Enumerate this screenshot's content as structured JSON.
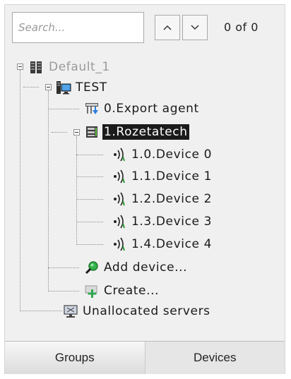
{
  "search": {
    "placeholder": "Search...",
    "value": ""
  },
  "counter": {
    "text": "0 of 0"
  },
  "tree": {
    "root": {
      "label": "Default_1",
      "icon": "server-rack-icon"
    },
    "server": {
      "label": "TEST",
      "icon": "computer-server-icon"
    },
    "export_agent": {
      "label": "0.Export agent",
      "icon": "export-agent-icon"
    },
    "device_group": {
      "label": "1.Rozetatech",
      "icon": "video-device-icon"
    },
    "devices": [
      {
        "label": "1.0.Device 0",
        "icon": "camera-signal-icon"
      },
      {
        "label": "1.1.Device 1",
        "icon": "camera-signal-icon"
      },
      {
        "label": "1.2.Device 2",
        "icon": "camera-signal-icon"
      },
      {
        "label": "1.3.Device 3",
        "icon": "camera-signal-icon"
      },
      {
        "label": "1.4.Device 4",
        "icon": "camera-signal-icon"
      }
    ],
    "add_device": {
      "label": "Add device...",
      "icon": "magnifier-add-icon"
    },
    "create": {
      "label": "Create...",
      "icon": "create-plus-icon"
    },
    "unallocated": {
      "label": "Unallocated servers",
      "icon": "unallocated-monitor-icon"
    }
  },
  "tabs": [
    {
      "label": "Groups"
    },
    {
      "label": "Devices"
    }
  ],
  "colors": {
    "selection_bg": "#1b1b1b",
    "selection_text": "#ffffff",
    "panel_bg": "#f0f0f0"
  }
}
